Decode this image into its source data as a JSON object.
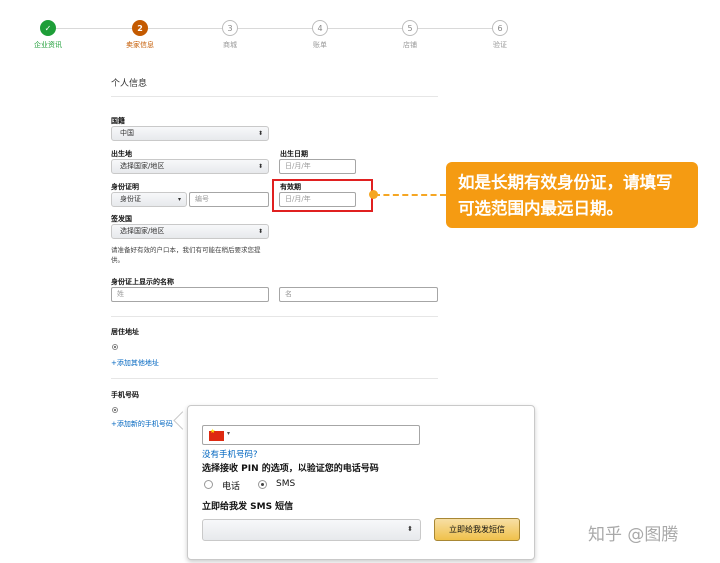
{
  "steps": [
    {
      "number": "",
      "label": "企业资讯",
      "state": "done"
    },
    {
      "number": "2",
      "label": "卖家信息",
      "state": "active"
    },
    {
      "number": "3",
      "label": "商城",
      "state": "pending"
    },
    {
      "number": "4",
      "label": "账单",
      "state": "pending"
    },
    {
      "number": "5",
      "label": "店铺",
      "state": "pending"
    },
    {
      "number": "6",
      "label": "验证",
      "state": "pending"
    }
  ],
  "form": {
    "section_title": "个人信息",
    "nationality": {
      "label": "国籍",
      "value": "中国"
    },
    "birthplace": {
      "label": "出生地",
      "value": "选择国家/地区"
    },
    "birthdate": {
      "label": "出生日期",
      "placeholder": "日/月/年"
    },
    "id_proof": {
      "label": "身份证明",
      "type_value": "身份证",
      "number_placeholder": "编号"
    },
    "expiry": {
      "label": "有效期",
      "placeholder": "日/月/年"
    },
    "issuing_country": {
      "label": "签发国",
      "value": "选择国家/地区"
    },
    "note": "请准备好有效的户口本，我们有可能在稍后要求您提供。",
    "name_on_id": {
      "label": "身份证上显示的名称",
      "last_placeholder": "姓",
      "first_placeholder": "名"
    },
    "address": {
      "label": "居住地址",
      "add_link": "+添加其他地址"
    },
    "phone": {
      "label": "手机号码",
      "add_link": "+添加新的手机号码"
    }
  },
  "callout": {
    "text": "如是长期有效身份证，请填写可选范围内最远日期。"
  },
  "popup": {
    "no_phone_link": "没有手机号码?",
    "pin_prompt": "选择接收 PIN 的选项，以验证您的电话号码",
    "option_call": "电话",
    "option_sms": "SMS",
    "sms_heading": "立即给我发 SMS 短信",
    "select_value": "",
    "send_button": "立即给我发短信"
  },
  "watermark": "知乎 @图腾",
  "colors": {
    "done": "#1e9e38",
    "active": "#c45a00",
    "highlight": "#e02020",
    "callout": "#f59b12",
    "link": "#0066c0"
  }
}
